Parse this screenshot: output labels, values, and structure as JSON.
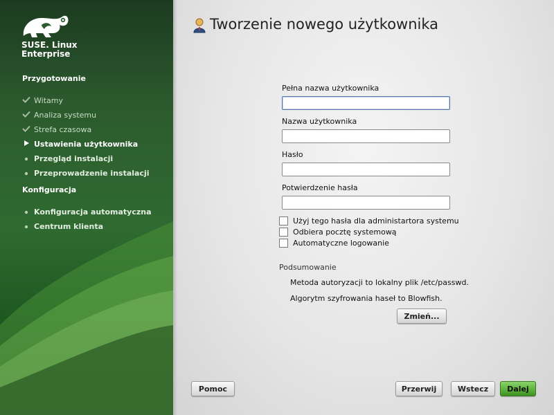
{
  "sidebar": {
    "brand_line1": "SUSE. Linux",
    "brand_line2": "Enterprise",
    "sections": [
      {
        "title": "Przygotowanie",
        "steps": [
          {
            "label": "Witamy",
            "state": "done"
          },
          {
            "label": "Analiza systemu",
            "state": "done"
          },
          {
            "label": "Strefa czasowa",
            "state": "done"
          },
          {
            "label": "Ustawienia użytkownika",
            "state": "current"
          },
          {
            "label": "Przegląd instalacji",
            "state": "todo"
          },
          {
            "label": "Przeprowadzenie instalacji",
            "state": "todo"
          }
        ]
      },
      {
        "title": "Konfiguracja",
        "steps": [
          {
            "label": "Konfiguracja automatyczna",
            "state": "todo"
          },
          {
            "label": "Centrum klienta",
            "state": "todo"
          }
        ]
      }
    ],
    "icons": {
      "done": "checkmark-icon",
      "current": "arrow-right-icon",
      "todo": "bullet-icon"
    }
  },
  "main": {
    "title": "Tworzenie nowego użytkownika",
    "title_icon": "user-icon",
    "form": {
      "full_name_label": "Pełna nazwa użytkownika",
      "full_name_value": "",
      "username_label": "Nazwa użytkownika",
      "username_value": "",
      "password_label": "Hasło",
      "password_value": "",
      "confirm_label": "Potwierdzenie hasła",
      "confirm_value": ""
    },
    "checkboxes": [
      {
        "label": "Użyj tego hasła dla administartora systemu",
        "checked": false
      },
      {
        "label": "Odbiera pocztę systemową",
        "checked": false
      },
      {
        "label": "Automatyczne logowanie",
        "checked": false
      }
    ],
    "summary": {
      "title": "Podsumowanie",
      "line1": "Metoda autoryzacji to lokalny plik /etc/passwd.",
      "line2": "Algorytm szyfrowania haseł to Blowfish.",
      "change_button": "Zmień..."
    }
  },
  "footer": {
    "help": "Pomoc",
    "abort": "Przerwij",
    "back": "Wstecz",
    "next": "Dalej"
  },
  "colors": {
    "sidebar_green": "#2f6a30",
    "accent_green": "#5bb03a"
  }
}
